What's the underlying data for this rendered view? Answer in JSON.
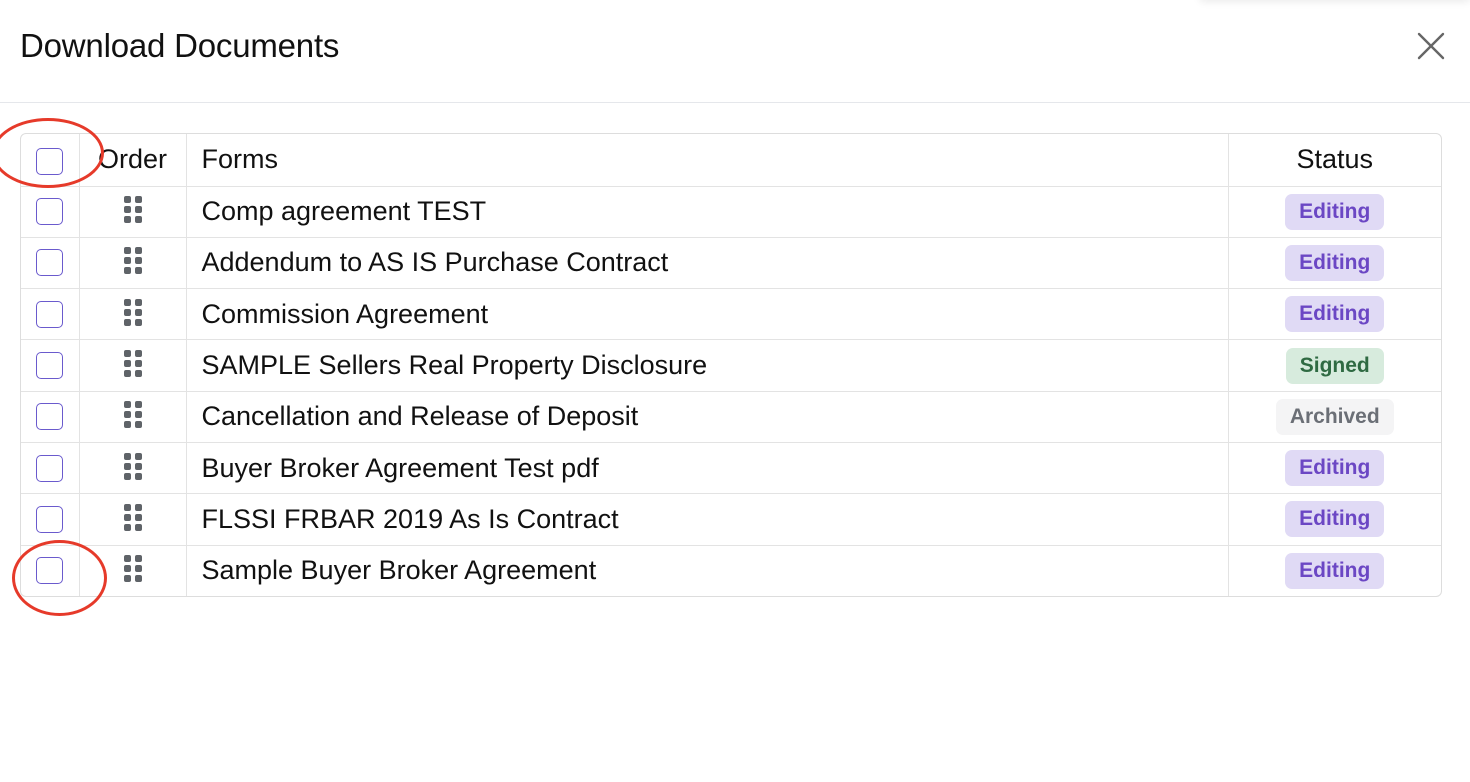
{
  "modal": {
    "title": "Download Documents",
    "close_icon": "close-icon"
  },
  "table": {
    "headers": {
      "order": "Order",
      "forms": "Forms",
      "status": "Status"
    },
    "rows": [
      {
        "form": "Comp agreement TEST",
        "status": "Editing",
        "status_type": "editing"
      },
      {
        "form": "Addendum to AS IS Purchase Contract",
        "status": "Editing",
        "status_type": "editing"
      },
      {
        "form": "Commission Agreement",
        "status": "Editing",
        "status_type": "editing"
      },
      {
        "form": "SAMPLE Sellers Real Property Disclosure",
        "status": "Signed",
        "status_type": "signed"
      },
      {
        "form": "Cancellation and Release of Deposit",
        "status": "Archived",
        "status_type": "archived"
      },
      {
        "form": "Buyer Broker Agreement Test pdf",
        "status": "Editing",
        "status_type": "editing"
      },
      {
        "form": "FLSSI FRBAR 2019 As Is Contract",
        "status": "Editing",
        "status_type": "editing"
      },
      {
        "form": "Sample Buyer Broker Agreement",
        "status": "Editing",
        "status_type": "editing"
      }
    ]
  },
  "colors": {
    "checkbox_border": "#6a5acd",
    "editing_bg": "#e0daf5",
    "editing_text": "#6b47c4",
    "signed_bg": "#d7ebdd",
    "signed_text": "#2f6a42",
    "archived_bg": "#f4f4f5",
    "archived_text": "#6b6f76",
    "annotation": "#e63a2a"
  },
  "icons": {
    "drag_handle": "drag-handle-icon",
    "close": "close-icon"
  }
}
